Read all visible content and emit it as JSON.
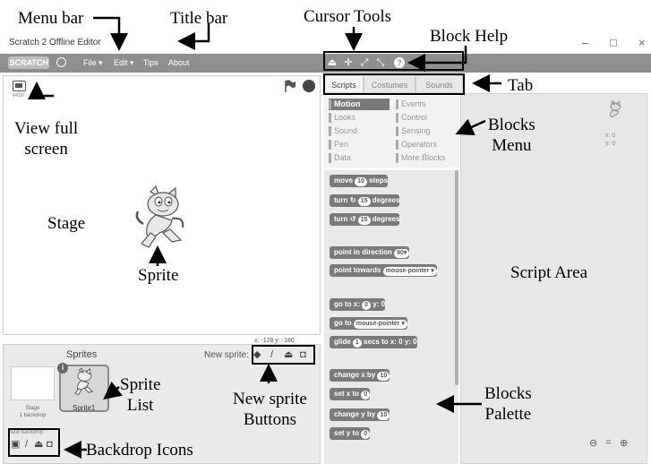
{
  "window": {
    "title": "Scratch 2 Offline Editor",
    "buttons": {
      "minimize": "–",
      "maximize": "□",
      "close": "×"
    }
  },
  "menubar": {
    "logo": "SCRATCH",
    "items": [
      "File ▾",
      "Edit ▾",
      "Tips",
      "About"
    ]
  },
  "cursor_tools": [
    "duplicate-stamp-icon",
    "move-cross-icon",
    "grow-icon",
    "shrink-icon",
    "help-icon"
  ],
  "stage": {
    "version": "v450",
    "coords": "x: -128  y: -180"
  },
  "sprites_panel": {
    "title": "Sprites",
    "new_sprite_label": "New sprite:",
    "stage_thumb_label": "Stage\n1 backdrop",
    "sprite1_label": "Sprite1",
    "new_backdrop_label": "New backdrop:"
  },
  "tabs": [
    "Scripts",
    "Costumes",
    "Sounds"
  ],
  "block_categories": {
    "left": [
      "Motion",
      "Looks",
      "Sound",
      "Pen",
      "Data"
    ],
    "right": [
      "Events",
      "Control",
      "Sensing",
      "Operators",
      "More Blocks"
    ],
    "selected": "Motion"
  },
  "blocks": [
    {
      "pre": "move",
      "val": "10",
      "post": "steps"
    },
    {
      "pre": "turn ↻",
      "val": "15",
      "post": "degrees"
    },
    {
      "pre": "turn ↺",
      "val": "15",
      "post": "degrees"
    },
    {
      "pre": "point in direction",
      "val": "90▾",
      "post": ""
    },
    {
      "pre": "point towards",
      "val": "mouse-pointer ▾",
      "post": ""
    },
    {
      "pre": "go to x:",
      "val": "0",
      "post": "y: 0"
    },
    {
      "pre": "go to",
      "val": "mouse-pointer ▾",
      "post": ""
    },
    {
      "pre": "glide",
      "val": "1",
      "post": "secs to x: 0 y: 0"
    },
    {
      "pre": "change x by",
      "val": "10",
      "post": ""
    },
    {
      "pre": "set x to",
      "val": "0",
      "post": ""
    },
    {
      "pre": "change y by",
      "val": "10",
      "post": ""
    },
    {
      "pre": "set y to",
      "val": "0",
      "post": ""
    }
  ],
  "script_area": {
    "coords": "x: 0\ny: 0",
    "zoom": [
      "🔍−",
      "=",
      "🔍+"
    ]
  },
  "annotations": {
    "menu_bar": "Menu bar",
    "title_bar": "Title bar",
    "cursor_tools": "Cursor Tools",
    "block_help": "Block Help",
    "tab": "Tab",
    "view_full_screen": "View full\nscreen",
    "blocks_menu": "Blocks\nMenu",
    "stage": "Stage",
    "sprite": "Sprite",
    "script_area": "Script Area",
    "sprite_list": "Sprite\nList",
    "new_sprite_buttons": "New sprite\nButtons",
    "blocks_palette": "Blocks\nPalette",
    "backdrop_icons": "Backdrop Icons"
  }
}
